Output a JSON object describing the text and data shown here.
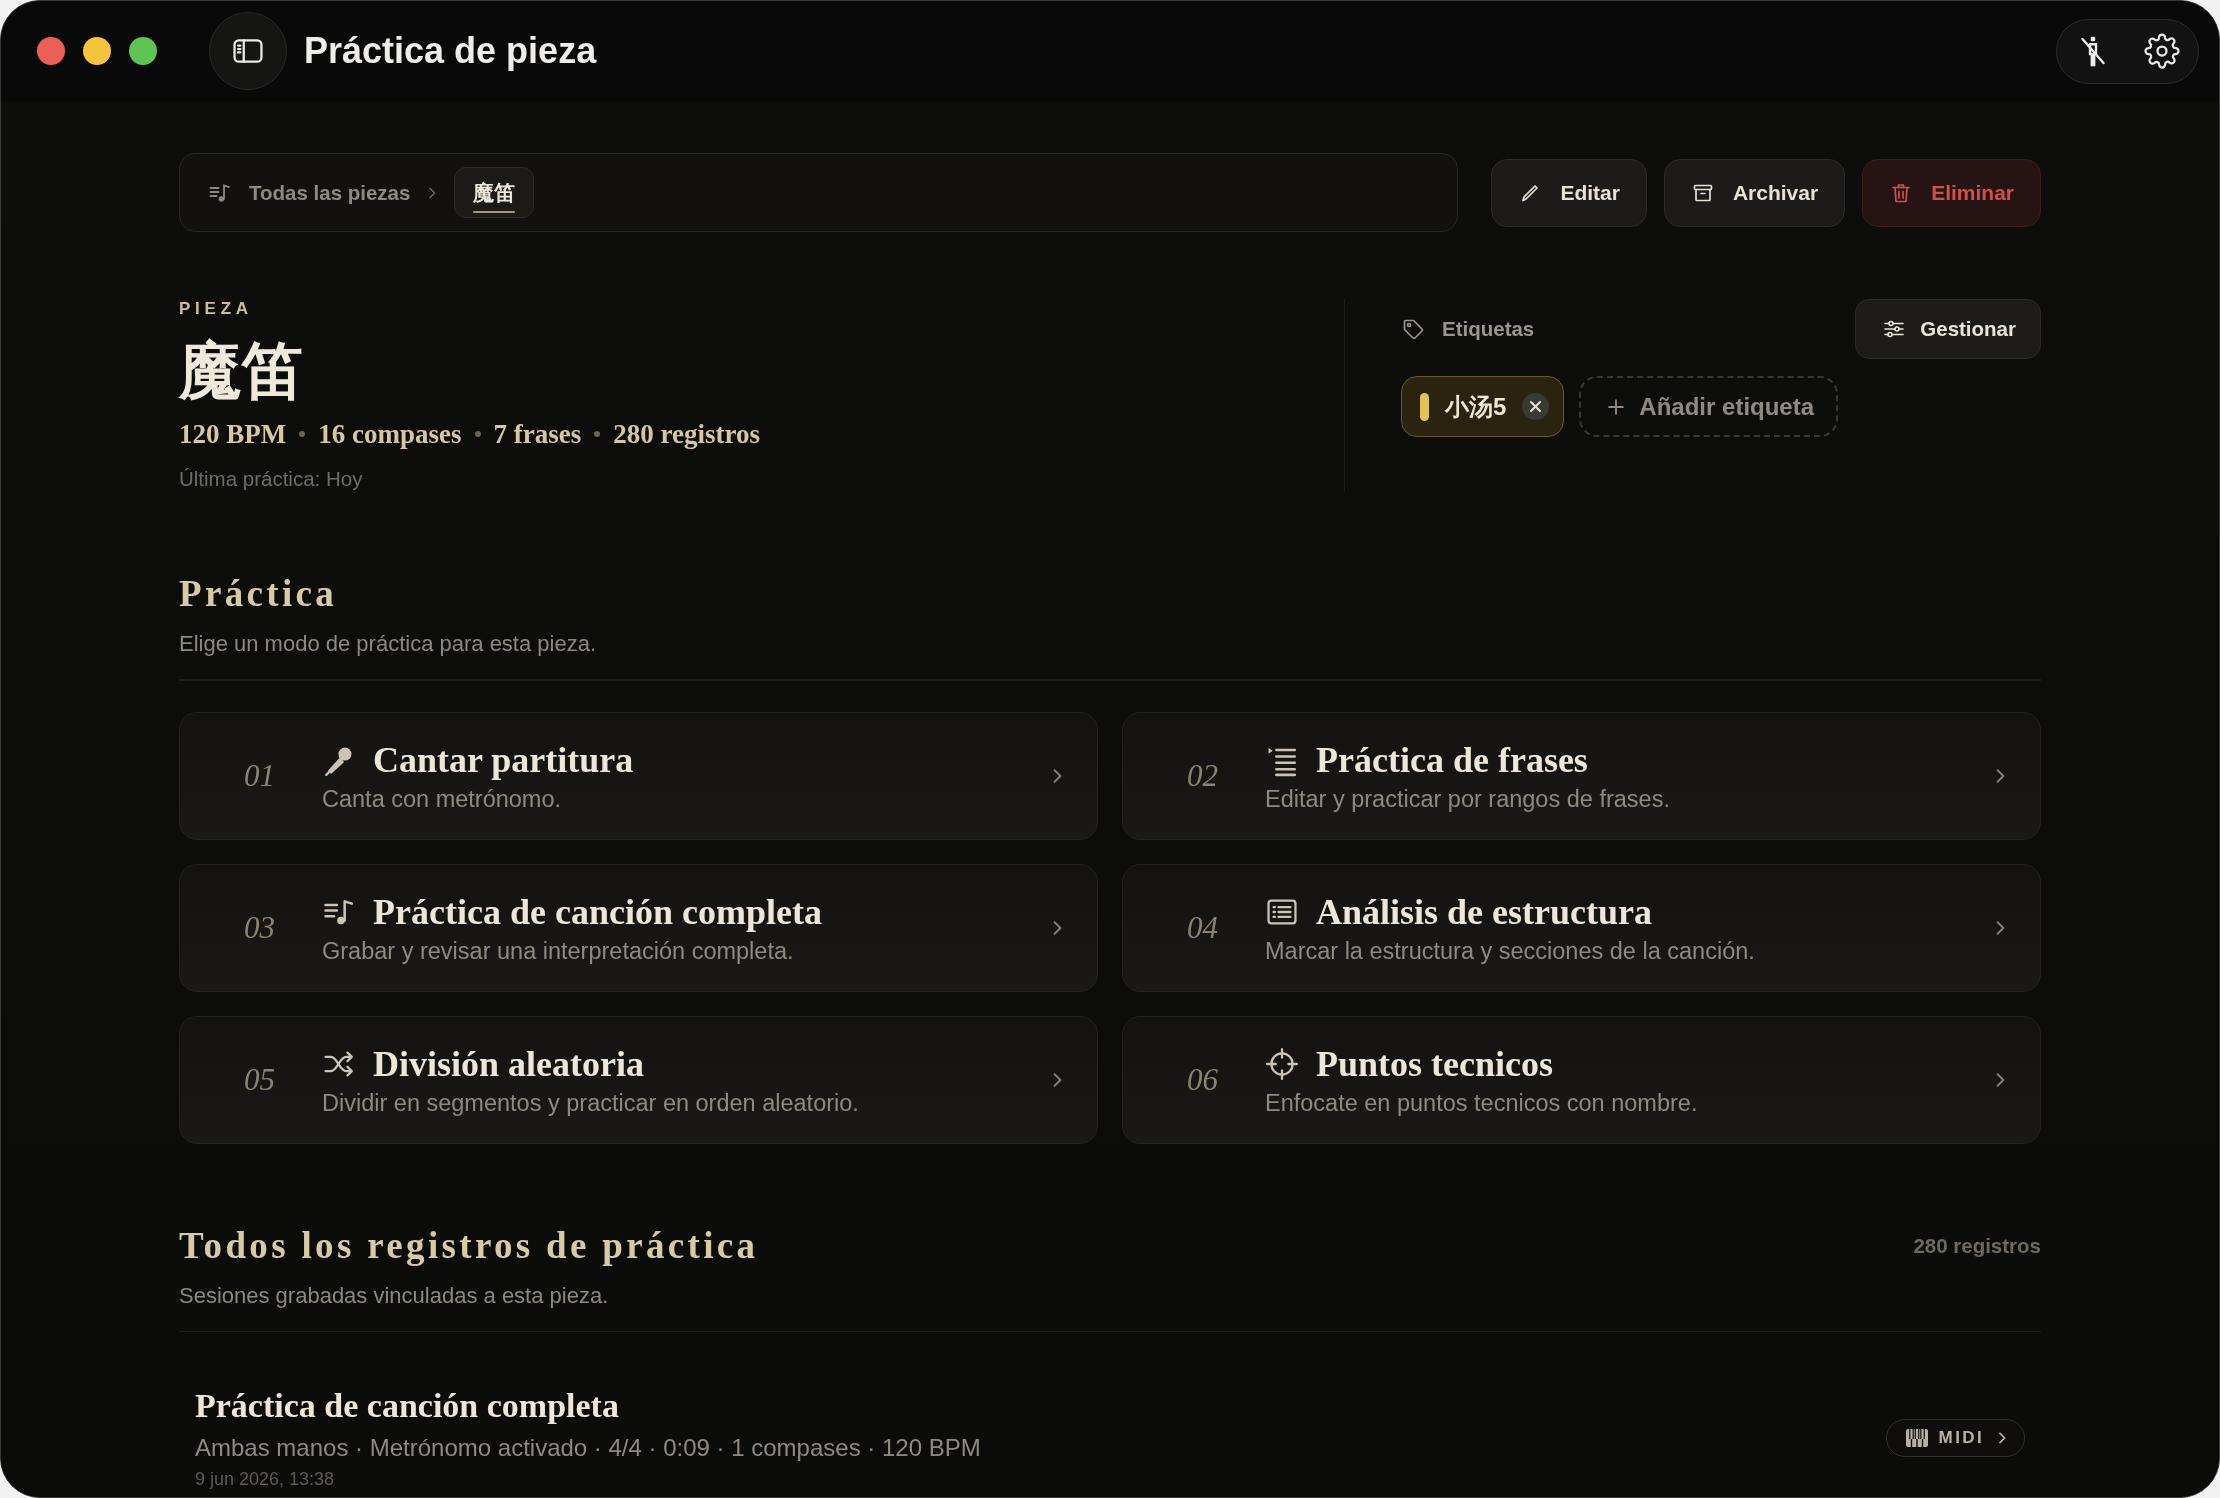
{
  "window": {
    "title": "Práctica de pieza"
  },
  "breadcrumb": {
    "items": [
      {
        "label": "Todas las piezas",
        "selected": false
      },
      {
        "label": "魔笛",
        "selected": true
      }
    ]
  },
  "actions": [
    {
      "label": "Editar",
      "kind": "edit"
    },
    {
      "label": "Archivar",
      "kind": "archive"
    },
    {
      "label": "Eliminar",
      "kind": "delete"
    }
  ],
  "piece": {
    "eyebrow": "PIEZA",
    "title": "魔笛",
    "stats": [
      "120 BPM",
      "16 compases",
      "7 frases",
      "280 registros"
    ],
    "last_practice": "Última práctica: Hoy"
  },
  "tags": {
    "heading": "Etiquetas",
    "manage_button": "Gestionar",
    "items": [
      {
        "label": "小汤5",
        "color": "#e2c35a"
      }
    ],
    "add_button": "Añadir etiqueta"
  },
  "practice": {
    "title": "Práctica",
    "subtitle": "Elige un modo de práctica para esta pieza.",
    "modes": [
      {
        "number": "01",
        "kind": "sing",
        "title": "Cantar partitura",
        "description": "Canta con metrónomo."
      },
      {
        "number": "02",
        "kind": "phrases",
        "title": "Práctica de frases",
        "description": "Editar y practicar por rangos de frases."
      },
      {
        "number": "03",
        "kind": "full_song",
        "title": "Práctica de canción completa",
        "description": "Grabar y revisar una interpretación completa."
      },
      {
        "number": "04",
        "kind": "structure",
        "title": "Análisis de estructura",
        "description": "Marcar la estructura y secciones de la canción."
      },
      {
        "number": "05",
        "kind": "random",
        "title": "División aleatoria",
        "description": "Dividir en segmentos y practicar en orden aleatorio."
      },
      {
        "number": "06",
        "kind": "technique",
        "title": "Puntos tecnicos",
        "description": "Enfocate en puntos tecnicos con nombre."
      }
    ]
  },
  "records": {
    "title": "Todos los registros de práctica",
    "count": "280 registros",
    "subtitle": "Sesiones grabadas vinculadas a esta pieza.",
    "items": [
      {
        "title": "Práctica de canción completa",
        "details": "Ambas manos · Metrónomo activado · 4/4 · 0:09 · 1 compases · 120 BPM",
        "date": "9 jun 2026, 13:38",
        "badge": "MIDI"
      }
    ]
  }
}
